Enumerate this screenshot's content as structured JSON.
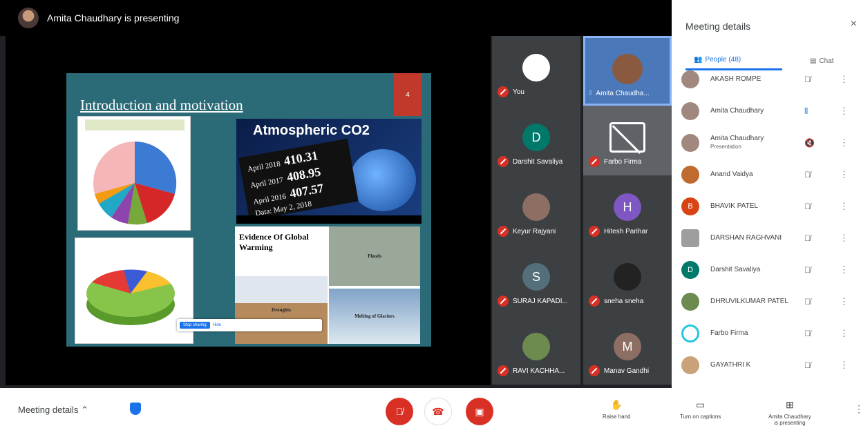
{
  "presenting_banner": "Amita Chaudhary is presenting",
  "slide": {
    "title": "Introduction and motivation",
    "number": "4",
    "co2_title": "Atmospheric CO2",
    "co2_readings": [
      {
        "label": "April 2018",
        "value": "410.31"
      },
      {
        "label": "April 2017",
        "value": "408.95"
      },
      {
        "label": "April 2016",
        "value": "407.57"
      }
    ],
    "co2_date": "Data: May 2, 2018",
    "warming_title": "Evidence Of Global Warming",
    "tiles": [
      "Floods",
      "Droughts",
      "Melting of Glaciers"
    ]
  },
  "share_pill": {
    "stop": "Stop sharing",
    "hide": "Hide"
  },
  "participants_grid": [
    {
      "name": "You",
      "initial": "",
      "color": "#3c4043",
      "muted": true
    },
    {
      "name": "Amita Chaudha...",
      "initial": "",
      "color": "#3c4043",
      "muted": false
    },
    {
      "name": "Darshit Savaliya",
      "initial": "D",
      "color": "#00796b",
      "muted": true
    },
    {
      "name": "Farbo Firma",
      "initial": "",
      "color": "#5f6368",
      "muted": true
    },
    {
      "name": "Keyur Rajyani",
      "initial": "",
      "color": "#8d6e63",
      "muted": true
    },
    {
      "name": "Hitesh Parihar",
      "initial": "H",
      "color": "#7e57c2",
      "muted": true
    },
    {
      "name": "SURAJ KAPADI...",
      "initial": "S",
      "color": "#546e7a",
      "muted": true
    },
    {
      "name": "sneha sneha",
      "initial": "",
      "color": "#222",
      "muted": true
    },
    {
      "name": "RAVI KACHHA...",
      "initial": "",
      "color": "#6d8b4f",
      "muted": true
    },
    {
      "name": "Manav Gandhi",
      "initial": "M",
      "color": "#8d6e63",
      "muted": true
    }
  ],
  "side_panel": {
    "title": "Meeting details",
    "close": "×",
    "tab_people": "People (48)",
    "tab_chat": "Chat",
    "people": [
      {
        "name": "AKASH ROMPE",
        "sub": "",
        "initial": "",
        "color": "#a1887f"
      },
      {
        "name": "Amita Chaudhary",
        "sub": "",
        "initial": "",
        "color": "#a1887f"
      },
      {
        "name": "Amita Chaudhary",
        "sub": "Presentation",
        "initial": "",
        "color": "#a1887f"
      },
      {
        "name": "Anand Vaidya",
        "sub": "",
        "initial": "",
        "color": "#bf6b2f"
      },
      {
        "name": "BHAVIK PATEL",
        "sub": "",
        "initial": "B",
        "color": "#d84315"
      },
      {
        "name": "DARSHAN RAGHVANI",
        "sub": "",
        "initial": "",
        "color": "#9e9e9e"
      },
      {
        "name": "Darshit Savaliya",
        "sub": "",
        "initial": "D",
        "color": "#00796b"
      },
      {
        "name": "DHRUVILKUMAR PATEL",
        "sub": "",
        "initial": "",
        "color": "#6d8b4f"
      },
      {
        "name": "Farbo Firma",
        "sub": "",
        "initial": "",
        "color": "#26c6da"
      },
      {
        "name": "GAYATHRI K",
        "sub": "",
        "initial": "",
        "color": "#c9a27a"
      }
    ]
  },
  "bottom_bar": {
    "meeting_details": "Meeting details",
    "raise_hand": "Raise hand",
    "captions": "Turn on captions",
    "presenting_line1": "Amita Chaudhary",
    "presenting_line2": "is presenting"
  }
}
